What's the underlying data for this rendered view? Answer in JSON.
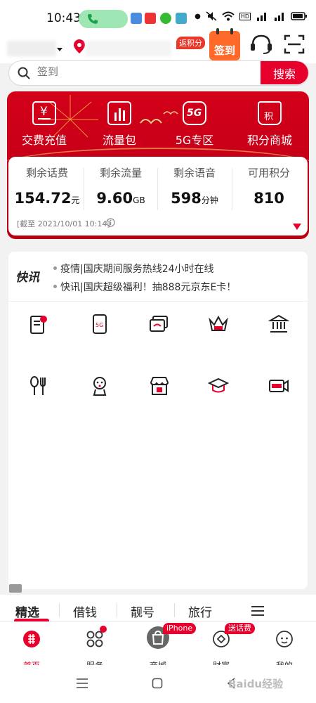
{
  "status_bar": {
    "time": "10:43"
  },
  "header": {
    "points_badge": "返积分",
    "checkin_label": "签到"
  },
  "search": {
    "placeholder": "签到",
    "button": "搜索"
  },
  "quick_actions": [
    {
      "label": "交费充值",
      "icon": "yen-card-icon"
    },
    {
      "label": "流量包",
      "icon": "data-chart-icon"
    },
    {
      "label": "5G专区",
      "icon": "5g-icon"
    },
    {
      "label": "积分商城",
      "icon": "points-bag-icon"
    }
  ],
  "balance": {
    "items": [
      {
        "label": "剩余话费",
        "value": "154.72",
        "unit": "元"
      },
      {
        "label": "剩余流量",
        "value": "9.60",
        "unit": "GB"
      },
      {
        "label": "剩余语音",
        "value": "598",
        "unit": "分钟"
      },
      {
        "label": "可用积分",
        "value": "810",
        "unit": ""
      }
    ],
    "as_of": "[截至 2021/10/01 10:14]"
  },
  "news": {
    "logo": "快讯",
    "items": [
      "疫情|国庆期间服务热线24小时在线",
      "快讯|国庆超级福利！抽888元京东E卡！"
    ]
  },
  "grid_icons": [
    "bill-icon",
    "5g-phone-icon",
    "wifi-cards-icon",
    "plus-crown-icon",
    "bank-icon",
    "dining-icon",
    "mascot-icon",
    "store-icon",
    "graduation-cap-icon",
    "live-video-icon"
  ],
  "tabs": [
    "精选",
    "借钱",
    "靓号",
    "旅行"
  ],
  "bottom_nav": [
    {
      "label": "首页",
      "icon": "home-icon",
      "active": true
    },
    {
      "label": "服务",
      "icon": "services-icon"
    },
    {
      "label": "商城",
      "icon": "shop-bag-icon",
      "badge": "iPhone"
    },
    {
      "label": "财富",
      "icon": "wealth-icon",
      "badge": "送话费"
    },
    {
      "label": "我的",
      "icon": "profile-icon"
    }
  ],
  "watermark": "Baidu经验",
  "colors": {
    "brand_red": "#e8002d",
    "banner_red": "#c40016",
    "checkin_orange": "#ff6a2a"
  }
}
